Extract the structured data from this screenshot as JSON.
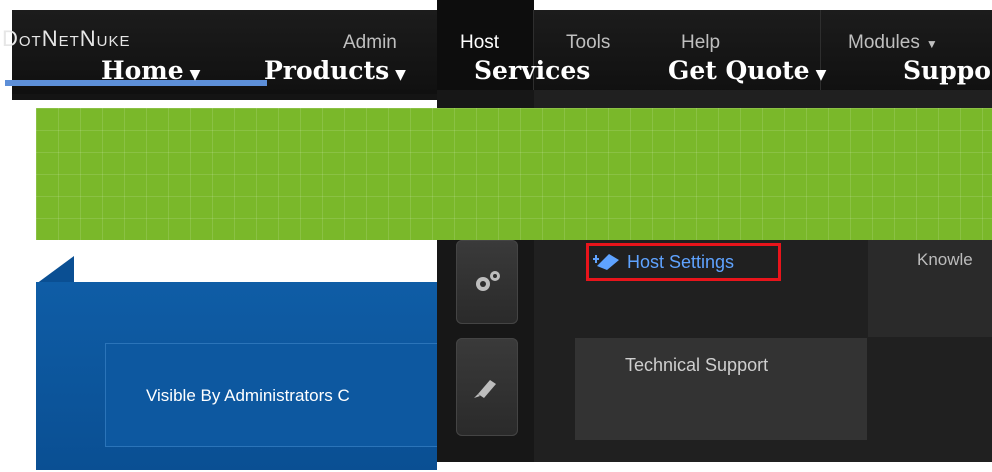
{
  "control_bar": {
    "logo": "DotNetNuke",
    "menu": [
      {
        "label": "Admin",
        "active": false
      },
      {
        "label": "Host",
        "active": true
      },
      {
        "label": "Tools",
        "active": false
      },
      {
        "label": "Help",
        "active": false
      },
      {
        "label": "Modules",
        "active": false
      }
    ]
  },
  "host_menu": {
    "items": {
      "host_settings": "Host Settings",
      "knowledge": "Knowle",
      "technical_support": "Technical Support"
    },
    "side_icons": [
      "gears-icon",
      "pin-icon"
    ]
  },
  "site_nav": {
    "items": [
      {
        "label": "Home",
        "has_dropdown": true
      },
      {
        "label": "Products",
        "has_dropdown": true
      },
      {
        "label": "Services",
        "has_dropdown": false
      },
      {
        "label": "Get Quote",
        "has_dropdown": true
      },
      {
        "label": "Suppo",
        "has_dropdown": false
      }
    ],
    "color": "#7ab82a"
  },
  "content": {
    "visibility_notice": "Visible By Administrators C"
  },
  "colors": {
    "highlight_border": "#e8141b",
    "link": "#5fa3ff",
    "panel_blue": "#0a4f93"
  }
}
